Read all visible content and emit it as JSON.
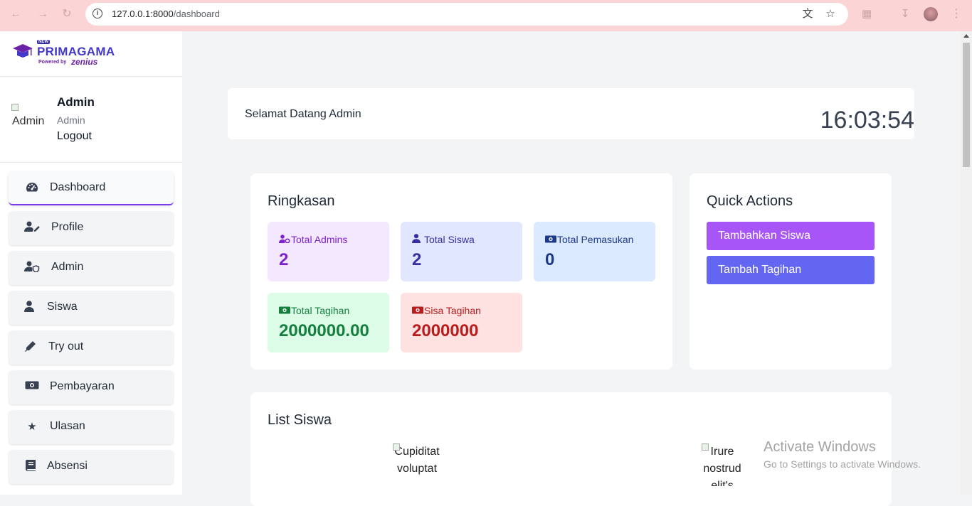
{
  "browser": {
    "url_host": "127.0.0.1:8000",
    "url_path": "/dashboard"
  },
  "sidebar": {
    "brand_new": "NEW",
    "brand_name": "PRIMAGAMA",
    "brand_powered": "Powered by",
    "brand_zenius": "zenius",
    "user": {
      "avatar_alt": "Admin",
      "name": "Admin",
      "role": "Admin",
      "logout": "Logout"
    },
    "items": [
      {
        "label": "Dashboard",
        "icon": "gauge-icon"
      },
      {
        "label": "Profile",
        "icon": "user-pen-icon"
      },
      {
        "label": "Admin",
        "icon": "user-shield-icon"
      },
      {
        "label": "Siswa",
        "icon": "user-icon"
      },
      {
        "label": "Try out",
        "icon": "pen-icon"
      },
      {
        "label": "Pembayaran",
        "icon": "money-bill-icon"
      },
      {
        "label": "Ulasan",
        "icon": "star-icon"
      },
      {
        "label": "Absensi",
        "icon": "book-icon"
      }
    ]
  },
  "welcome": {
    "message": "Selamat Datang Admin",
    "clock": "16:03:54"
  },
  "summary": {
    "title": "Ringkasan",
    "stats": [
      {
        "label": "Total Admins",
        "value": "2",
        "bg": "#f3e8ff",
        "fg": "#7e22ce",
        "icon": "user-gear-icon"
      },
      {
        "label": "Total Siswa",
        "value": "2",
        "bg": "#e0e7ff",
        "fg": "#3730a3",
        "icon": "user-icon"
      },
      {
        "label": "Total Pemasukan",
        "value": "0",
        "bg": "#dbeafe",
        "fg": "#1e3a8a",
        "icon": "money-bill-icon"
      },
      {
        "label": "Total Tagihan",
        "value": "2000000.00",
        "bg": "#dcfce7",
        "fg": "#15803d",
        "icon": "money-bill-icon"
      },
      {
        "label": "Sisa Tagihan",
        "value": "2000000",
        "bg": "#fee2e2",
        "fg": "#b91c1c",
        "icon": "money-bill-icon"
      }
    ]
  },
  "quick_actions": {
    "title": "Quick Actions",
    "buttons": [
      {
        "label": "Tambahkan Siswa",
        "color": "#a855f7"
      },
      {
        "label": "Tambah Tagihan",
        "color": "#6366f1"
      }
    ]
  },
  "list_siswa": {
    "title": "List Siswa",
    "images": [
      {
        "alt": "Cupiditat voluptat"
      },
      {
        "alt": "Irure nostrud elit's"
      }
    ]
  },
  "watermark": {
    "line1": "Activate Windows",
    "line2": "Go to Settings to activate Windows."
  }
}
